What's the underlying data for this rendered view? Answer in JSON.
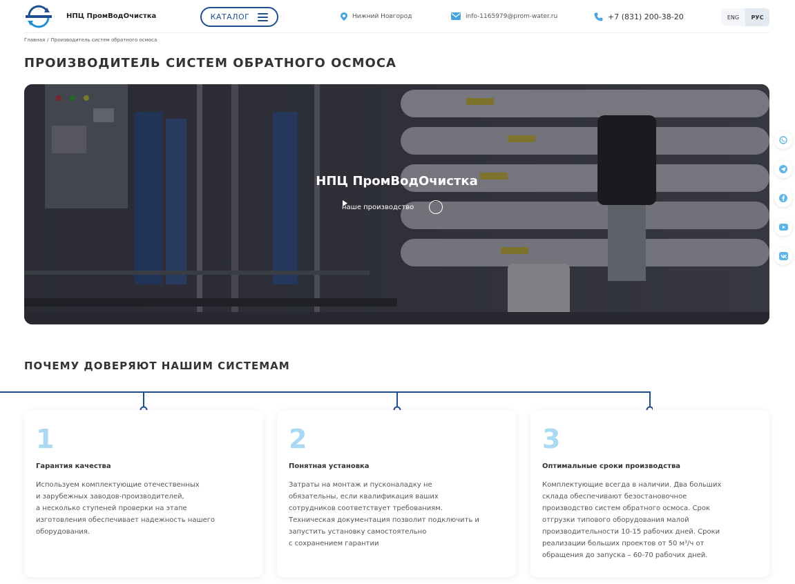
{
  "header": {
    "brand": "НПЦ ПромВодОчистка",
    "catalog_label": "КАТАЛОГ",
    "location": "Нижний Новгород",
    "email": "info-1165979@prom-water.ru",
    "phone": "+7 (831) 200-38-20",
    "languages": [
      {
        "label": "ENG",
        "active": false
      },
      {
        "label": "РУС",
        "active": true
      }
    ]
  },
  "breadcrumb": {
    "home": "Главная",
    "separator": "/",
    "current": "Производитель систем обратного осмоса"
  },
  "page_title": "ПРОИЗВОДИТЕЛЬ СИСТЕМ ОБРАТНОГО ОСМОСА",
  "hero": {
    "title": "НПЦ ПромВодОчистка",
    "link_label": "наше производство",
    "play_icon": "play-icon"
  },
  "social": [
    "whatsapp-icon",
    "telegram-icon",
    "facebook-icon",
    "youtube-icon",
    "vk-icon"
  ],
  "why": {
    "title": "ПОЧЕМУ ДОВЕРЯЮТ НАШИМ СИСТЕМАМ",
    "cards": [
      {
        "number": "1",
        "title": "Гарантия качества",
        "text": "Используем комплектующие отечественных\nи зарубежных заводов-производителей,\nа несколько ступеней проверки на этапе\nизготовления обеспечивает надежность нашего\nоборудования."
      },
      {
        "number": "2",
        "title": "Понятная установка",
        "text": "Затраты на монтаж и пусконаладку не\nобязательны, если квалификация ваших\nсотрудников соответствует требованиям.\nТехническая документация позволит подключить и\nзапустить установку самостоятельно\nс сохранением гарантии"
      },
      {
        "number": "3",
        "title": "Оптимальные сроки производства",
        "text": "Комплектующие всегда в наличии. Два больших\nсклада обеспечивают безостановочное\nпроизводство систем обратного осмоса. Срок\nотгрузки типового оборудования малой\nпроизводительности 10-15 рабочих дней. Сроки\nреализации больших проектов от 50 м³/ч от\nобращения до запуска – 60-70 рабочих дней."
      }
    ]
  },
  "colors": {
    "brand_blue": "#1d4e8f",
    "accent_light_blue": "#a9d9f3",
    "icon_blue": "#4aa3df"
  }
}
